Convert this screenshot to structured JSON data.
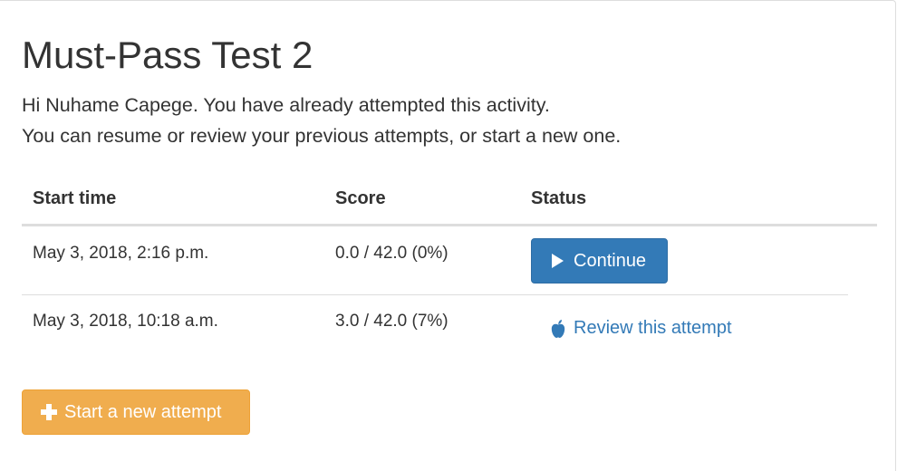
{
  "page": {
    "title": "Must-Pass Test 2",
    "intro_line1": "Hi Nuhame Capege. You have already attempted this activity.",
    "intro_line2": "You can resume or review your previous attempts, or start a new one."
  },
  "table": {
    "headers": {
      "start_time": "Start time",
      "score": "Score",
      "status": "Status"
    },
    "rows": [
      {
        "start_time": "May 3, 2018, 2:16 p.m.",
        "score": "0.0 / 42.0 (0%)",
        "action_label": "Continue",
        "action_icon": "play-icon"
      },
      {
        "start_time": "May 3, 2018, 10:18 a.m.",
        "score": "3.0 / 42.0 (7%)",
        "action_label": "Review this attempt",
        "action_icon": "apple-icon"
      }
    ]
  },
  "actions": {
    "start_new_label": "Start a new attempt",
    "start_new_icon": "plus-icon"
  },
  "colors": {
    "primary": "#337ab7",
    "warning": "#f0ad4e",
    "link": "#337ab7",
    "text": "#333333"
  }
}
